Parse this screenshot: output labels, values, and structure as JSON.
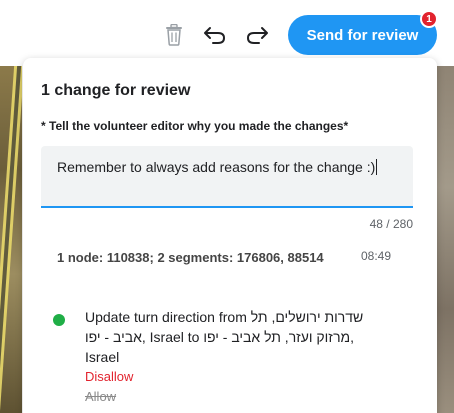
{
  "toolbar": {
    "trash_icon": "trash-icon",
    "undo_icon": "undo-icon",
    "redo_icon": "redo-icon",
    "send_label": "Send for review",
    "badge_count": "1",
    "accent_color": "#1f96f3",
    "badge_color": "#e2232e"
  },
  "panel": {
    "title": "1 change for review",
    "instruction": "* Tell the volunteer editor why you made the changes*",
    "comment_value": "Remember to always add reasons for the change :)",
    "char_counter": "48 / 280",
    "change": {
      "header": "1 node: 110838; 2 segments: 176806, 88514",
      "time": "08:49",
      "status_color": "#1fae46",
      "description_line1": "Update turn direction from שדרות ירושלים, תל",
      "description_line2": "אביב - יפו, Israel to מרזוק ועזר, תל אביב - יפו,",
      "description_line3": "Israel",
      "disallow_label": "Disallow",
      "allow_label": "Allow"
    }
  }
}
